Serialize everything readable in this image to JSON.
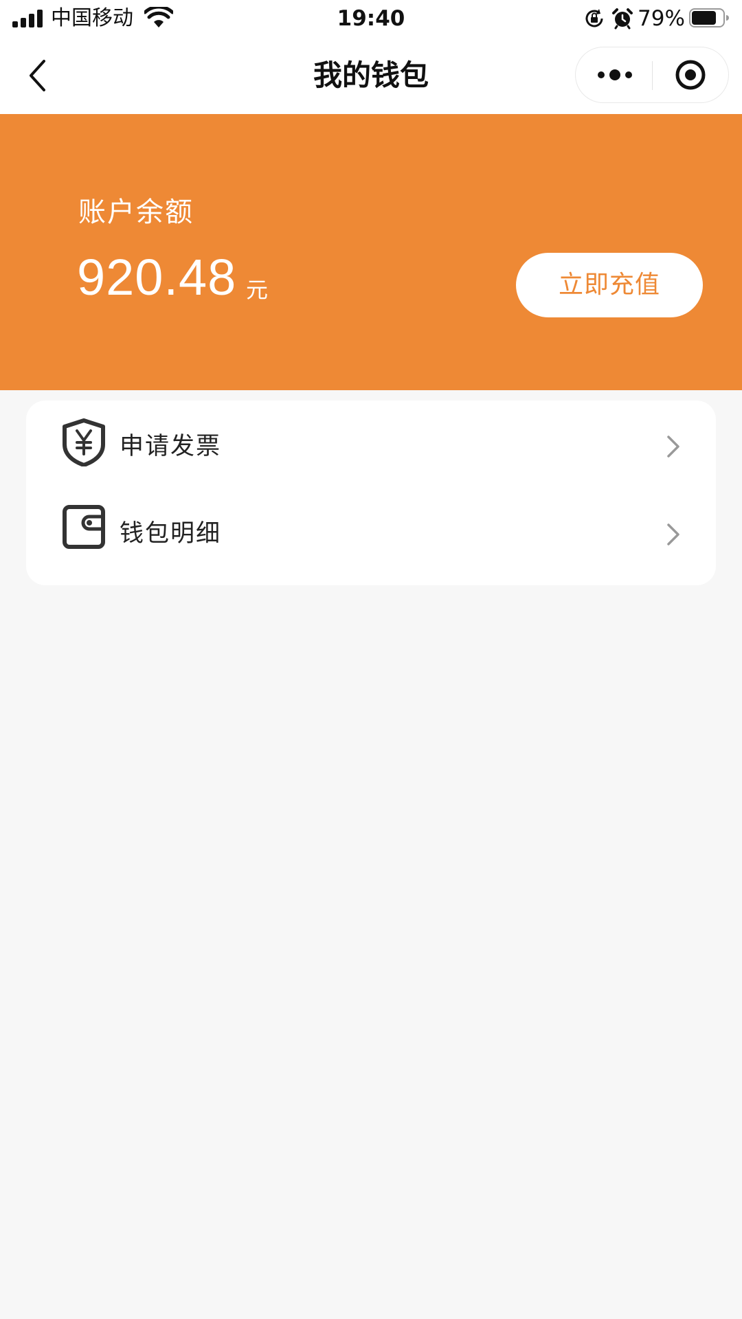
{
  "status_bar": {
    "carrier": "中国移动",
    "time": "19:40",
    "battery_percent": "79%",
    "battery_level": 0.79,
    "icons": [
      "signal-icon",
      "wifi-icon",
      "rotation-lock-icon",
      "alarm-icon",
      "battery-icon"
    ]
  },
  "nav": {
    "title": "我的钱包",
    "back_icon": "chevron-left-icon",
    "more_icon": "more-dots-icon",
    "close_icon": "target-circle-icon"
  },
  "balance": {
    "label": "账户余额",
    "amount": "920.48",
    "unit": "元",
    "recharge_label": "立即充值"
  },
  "menu": {
    "items": [
      {
        "label": "申请发票",
        "icon": "invoice-shield-icon"
      },
      {
        "label": "钱包明细",
        "icon": "wallet-icon"
      }
    ]
  },
  "colors": {
    "accent": "#ee8935",
    "page_background": "#f7f7f7",
    "card_background": "#ffffff",
    "text_primary": "#111111",
    "chevron": "#999999"
  }
}
